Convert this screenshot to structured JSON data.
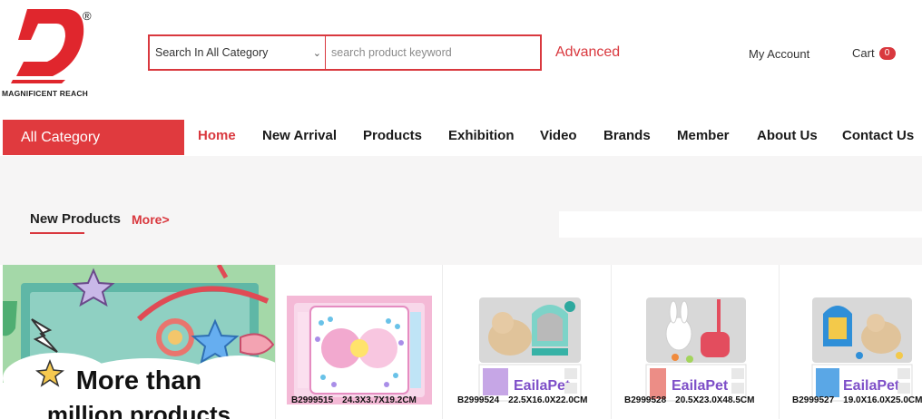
{
  "header": {
    "logo_brand": "MAGNIFICENT REACH",
    "logo_reg": "®",
    "search": {
      "category_selected": "Search In All Category",
      "placeholder": "search product keyword"
    },
    "advanced_label": "Advanced",
    "account_label": "My Account",
    "cart_label": "Cart",
    "cart_count": "0"
  },
  "nav": {
    "all_category": "All Category",
    "items": [
      "Home",
      "New Arrival",
      "Products",
      "Exhibition",
      "Video",
      "Brands",
      "Member",
      "About Us",
      "Contact Us"
    ],
    "active_index": 0
  },
  "section": {
    "title": "New Products",
    "more_label": "More>"
  },
  "banner": {
    "line1": "More than",
    "line2": "million products"
  },
  "products": [
    {
      "code": "B2999515",
      "size": "24.3X3.7X19.2CM"
    },
    {
      "code": "B2999524",
      "size": "22.5X16.0X22.0CM"
    },
    {
      "code": "B2999528",
      "size": "20.5X23.0X48.5CM"
    },
    {
      "code": "B2999527",
      "size": "19.0X16.0X25.0CM"
    }
  ],
  "colors": {
    "accent": "#d9383e",
    "banner_bg": "#a4d8a8"
  }
}
